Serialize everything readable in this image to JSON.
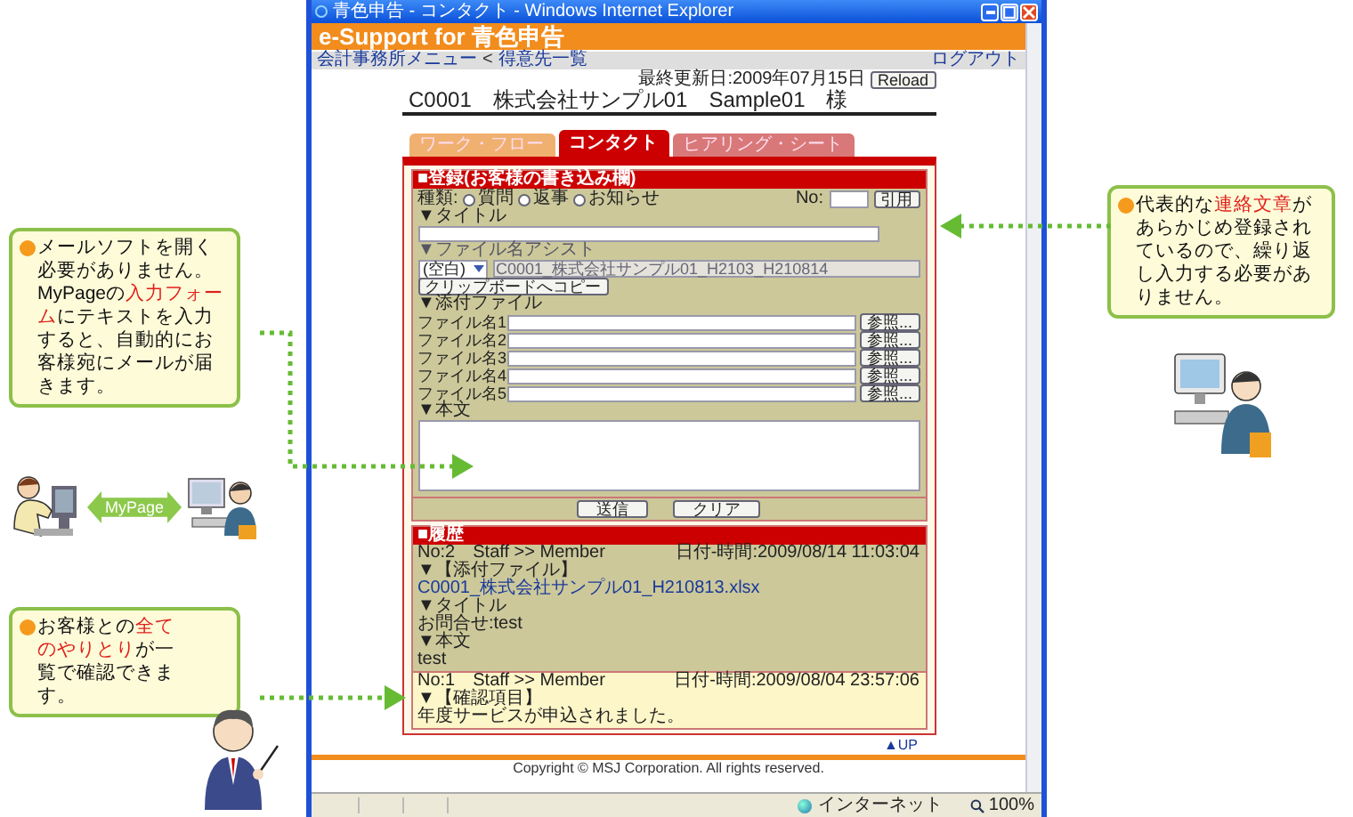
{
  "callouts_left": [
    {
      "parts": [
        {
          "text": "メールソフトを開く必要がありません。MyPageの",
          "highlight": false
        },
        {
          "text": "入力フォーム",
          "highlight": true
        },
        {
          "text": "にテキストを入力すると、自動的にお客様宛にメールが届きます。",
          "highlight": false
        }
      ]
    },
    {
      "parts": [
        {
          "text": "お客様との",
          "highlight": false
        },
        {
          "text": "全てのやりとり",
          "highlight": true
        },
        {
          "text": "が一覧で確認できます。",
          "highlight": false
        }
      ]
    }
  ],
  "exchange_label": "MyPage",
  "callout_right": {
    "parts": [
      {
        "text": "代表的な",
        "highlight": false
      },
      {
        "text": "連絡文章",
        "highlight": true
      },
      {
        "text": "があらかじめ登録されているので、繰り返し入力する必要がありません。",
        "highlight": false
      }
    ]
  },
  "browser": {
    "title": "青色申告 - コンタクト - Windows Internet Explorer",
    "site_title": "e-Support for 青色申告",
    "breadcrumb": [
      {
        "kind": "link",
        "text": "会計事務所メニュー"
      },
      {
        "kind": "separator",
        "text": "<"
      },
      {
        "kind": "link",
        "text": "得意先一覧"
      }
    ],
    "logout": "ログアウト"
  },
  "page": {
    "last_updated": "最終更新日:2009年07月15日",
    "reload": "Reload",
    "customer": "C0001　株式会社サンプル01　Sample01　様"
  },
  "tabs": [
    {
      "label": "ワーク・フロー",
      "selected": false,
      "color": "#f0b070"
    },
    {
      "label": "コンタクト",
      "selected": true,
      "color": "#cc0000"
    },
    {
      "label": "ヒアリング・シート",
      "selected": false,
      "color": "#d87878"
    }
  ],
  "form": {
    "heading": "■登録(お客様の書き込み欄)",
    "type_label": "種類:",
    "types": [
      {
        "label": "質問",
        "selected": false
      },
      {
        "label": "返事",
        "selected": false
      },
      {
        "label": "お知らせ",
        "selected": false
      }
    ],
    "no_label": "No:",
    "cite_button": "引用",
    "title_label": "▼タイトル",
    "assist_label": "▼ファイル名アシスト",
    "assist_select": "(空白)",
    "assist_value": "C0001_株式会社サンプル01_H2103_H210814",
    "copy_button": "クリップボードへコピー",
    "attach_label": "▼添付ファイル",
    "files": [
      {
        "label": "ファイル名1",
        "button": "参照..."
      },
      {
        "label": "ファイル名2",
        "button": "参照..."
      },
      {
        "label": "ファイル名3",
        "button": "参照..."
      },
      {
        "label": "ファイル名4",
        "button": "参照..."
      },
      {
        "label": "ファイル名5",
        "button": "参照..."
      }
    ],
    "body_label": "▼本文",
    "submit": "送信",
    "clear": "クリア"
  },
  "history": {
    "heading": "■履歴",
    "entries": [
      {
        "no": "No:2",
        "route": "Staff >> Member",
        "datetime": "日付-時間:2009/08/14 11:03:04",
        "sections": [
          {
            "label": "▼【添付ファイル】",
            "kind": "link",
            "text": "C0001_株式会社サンプル01_H210813.xlsx"
          },
          {
            "label": "▼タイトル",
            "kind": "text",
            "text": "お問合せ:test"
          },
          {
            "label": "▼本文",
            "kind": "text",
            "text": "test"
          }
        ]
      },
      {
        "no": "No:1",
        "route": "Staff >> Member",
        "datetime": "日付-時間:2009/08/04 23:57:06",
        "sections": [
          {
            "label": "▼【確認項目】",
            "kind": "text",
            "text": "年度サービスが申込されました。"
          }
        ]
      }
    ]
  },
  "footer": {
    "up": "▲UP",
    "copyright": "Copyright © MSJ Corporation. All rights reserved."
  },
  "status_bar": {
    "zone": "インターネット",
    "zoom": "100%"
  }
}
